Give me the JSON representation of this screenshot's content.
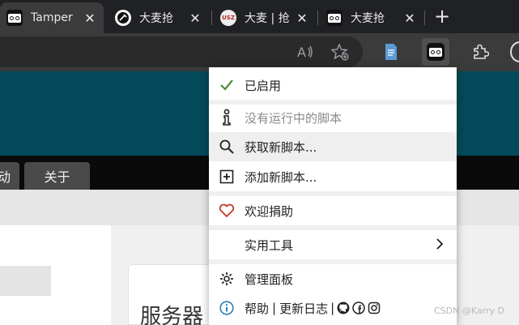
{
  "tabs": [
    {
      "title": "Tamper",
      "icon": "tampermonkey-icon",
      "active": true
    },
    {
      "title": "大麦抢",
      "icon": "damai-robot-icon",
      "active": false
    },
    {
      "title": "大麦 | 抢",
      "icon": "usz-icon",
      "active": false,
      "favicon_text": "USZ"
    },
    {
      "title": "大麦抢",
      "icon": "tampermonkey-icon",
      "active": false
    }
  ],
  "newtab_label": "+",
  "toolbar": {
    "read_aloud_icon": "read-aloud-icon",
    "favorite_icon": "add-favorite-icon",
    "extension_icon": "document-extension-icon",
    "tampermonkey_icon": "tampermonkey-icon",
    "extensions_icon": "puzzle-icon"
  },
  "page": {
    "nav_tab_left": "动",
    "nav_tab_about": "关于",
    "card_title": "服务器"
  },
  "menu": {
    "enabled": "已启用",
    "no_scripts": "没有运行中的脚本",
    "get_scripts": "获取新脚本...",
    "add_script": "添加新脚本...",
    "donate": "欢迎捐助",
    "utilities": "实用工具",
    "dashboard": "管理面板",
    "help": "帮助",
    "sep1": "|",
    "changelog": "更新日志",
    "sep2": "|"
  },
  "colors": {
    "check": "#4f8a3a",
    "heart": "#c0392b",
    "info": "#2a7fb0",
    "page_header": "#044a5a"
  },
  "watermark": "CSDN @Karry D"
}
